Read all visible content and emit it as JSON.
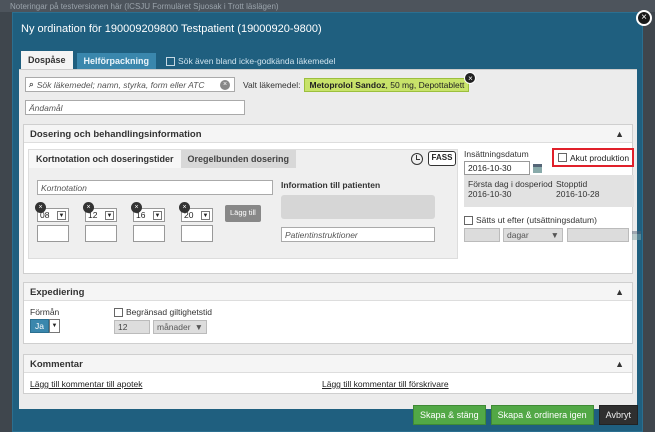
{
  "background": {
    "banner_text": "Noteringar på testversionen här (ICSJU Formuläret Sjuosak i Trott läslägen)"
  },
  "modal": {
    "title": "Ny ordination för 190009209800 Testpatient (19000920-9800)",
    "close_label": "×"
  },
  "tabs": [
    {
      "label": "Dospåse",
      "active": true
    },
    {
      "label": "Helförpackning",
      "active": false
    }
  ],
  "tab_checkbox_label": "Sök även bland icke-godkända läkemedel",
  "search": {
    "placeholder": "Sök läkemedel; namn, styrka, form eller ATC",
    "clear_label": "×",
    "selected_label": "Valt läkemedel:",
    "selected_name": "Metoprolol Sandoz",
    "selected_detail": ", 50 mg, Depottablett",
    "chip_close": "×"
  },
  "andamal": {
    "placeholder": "Ändamål"
  },
  "dosering": {
    "header": "Dosering och behandlingsinformation",
    "subtabs": [
      {
        "label": "Kortnotation och doseringstider",
        "active": true
      },
      {
        "label": "Oregelbunden dosering",
        "active": false
      }
    ],
    "fass_label": "FASS",
    "kortnotation_placeholder": "Kortnotation",
    "times": [
      "08",
      "12",
      "16",
      "20"
    ],
    "time_remove": "×",
    "lagg_till": "Lägg till",
    "info_label": "Information till patienten",
    "patient_placeholder": "Patientinstruktioner",
    "insattning_label": "Insättningsdatum",
    "insattning_date": "2016-10-30",
    "akut_label": "Akut produktion",
    "forsta_label": "Första dag i dosperiod",
    "forsta_date": "2016-10-30",
    "stopp_label": "Stopptid",
    "stopp_date": "2016-10-28",
    "satts_label": "Sätts ut efter (utsättningsdatum)",
    "dagar_label": "dagar"
  },
  "expediering": {
    "header": "Expediering",
    "forman_label": "Förmån",
    "forman_value": "Ja",
    "begransad_label": "Begränsad giltighetstid",
    "months_value": "12",
    "months_unit": "månader"
  },
  "kommentar": {
    "header": "Kommentar",
    "link_apotek": "Lägg till kommentar till apotek",
    "link_forskrivare": "Lägg till kommentar till förskrivare"
  },
  "buttons": {
    "skapa_stang": "Skapa & stäng",
    "skapa_ordinera": "Skapa & ordinera igen",
    "avbryt": "Avbryt"
  },
  "glyphs": {
    "caret_up": "▲",
    "select_arrow": "▼"
  }
}
